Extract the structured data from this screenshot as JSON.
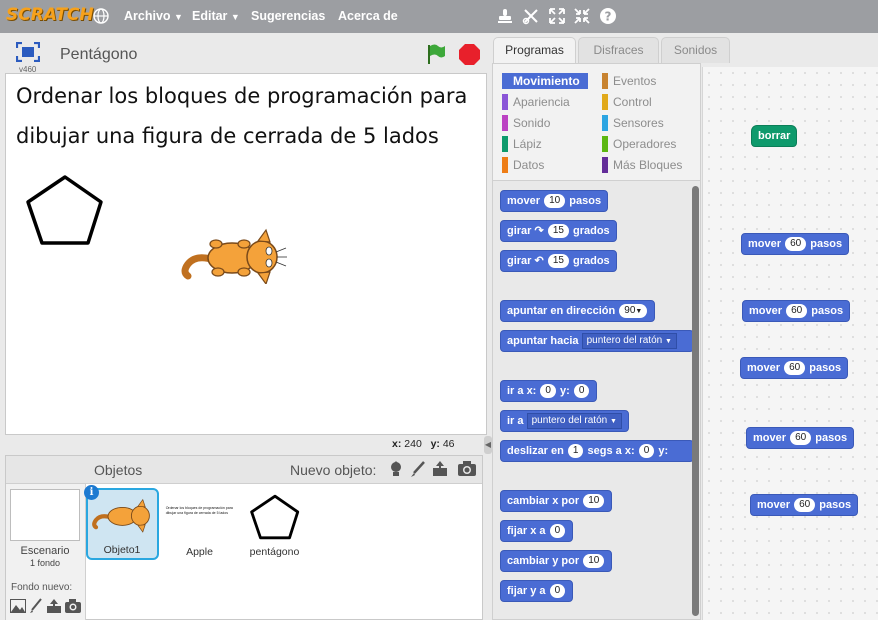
{
  "menubar": {
    "logo": "SCRATCH",
    "items": [
      "Archivo",
      "Editar",
      "Sugerencias",
      "Acerca de"
    ],
    "tool_icons": [
      "stamp-icon",
      "cut-icon",
      "grow-icon",
      "shrink-icon",
      "help-icon"
    ]
  },
  "stage": {
    "project_title": "Pentágono",
    "version": "v460",
    "text_line1": "Ordenar los bloques de programación para",
    "text_line2": "dibujar una figura de cerrada de 5 lados",
    "coords": {
      "x_label": "x:",
      "x_value": "240",
      "y_label": "y:",
      "y_value": "46"
    }
  },
  "sprites": {
    "header": "Objetos",
    "new_object": "Nuevo objeto:",
    "stage_label": "Escenario",
    "stage_count": "1 fondo",
    "new_backdrop": "Fondo nuevo:",
    "items": [
      {
        "name": "Objeto1",
        "selected": true
      },
      {
        "name": "Apple",
        "selected": false
      },
      {
        "name": "pentágono",
        "selected": false
      }
    ],
    "apple_thumb_text": "Ordenar los bloques de programación para dibujar una figura de cerrada de 5 lados"
  },
  "tabs": [
    "Programas",
    "Disfraces",
    "Sonidos"
  ],
  "categories": [
    {
      "label": "Movimiento",
      "color": "#4a6cd4"
    },
    {
      "label": "Eventos",
      "color": "#c88330"
    },
    {
      "label": "Apariencia",
      "color": "#8a55d7"
    },
    {
      "label": "Control",
      "color": "#e1a91a"
    },
    {
      "label": "Sonido",
      "color": "#bb42c3"
    },
    {
      "label": "Sensores",
      "color": "#2ca5e2"
    },
    {
      "label": "Lápiz",
      "color": "#0e9a6c"
    },
    {
      "label": "Operadores",
      "color": "#5cb712"
    },
    {
      "label": "Datos",
      "color": "#ee7d16"
    },
    {
      "label": "Más Bloques",
      "color": "#632d99"
    }
  ],
  "palette_blocks": {
    "move": {
      "pre": "mover",
      "val": "10",
      "post": "pasos"
    },
    "turn_right": {
      "pre": "girar",
      "val": "15",
      "post": "grados"
    },
    "turn_left": {
      "pre": "girar",
      "val": "15",
      "post": "grados"
    },
    "point_dir": {
      "pre": "apuntar en dirección",
      "val": "90"
    },
    "point_towards": {
      "pre": "apuntar hacia",
      "val": "puntero del ratón"
    },
    "goto_xy": {
      "pre": "ir a x:",
      "x": "0",
      "mid": "y:",
      "y": "0"
    },
    "goto": {
      "pre": "ir a",
      "val": "puntero del ratón"
    },
    "glide": {
      "pre": "deslizar en",
      "secs": "1",
      "mid": "segs a x:",
      "x": "0",
      "post": "y:"
    },
    "change_x": {
      "pre": "cambiar x por",
      "val": "10"
    },
    "set_x": {
      "pre": "fijar x a",
      "val": "0"
    },
    "change_y": {
      "pre": "cambiar y por",
      "val": "10"
    },
    "set_y": {
      "pre": "fijar y a",
      "val": "0"
    }
  },
  "scripts": {
    "clear_block": "borrar",
    "move_blocks": [
      {
        "pre": "mover",
        "val": "60",
        "post": "pasos"
      },
      {
        "pre": "mover",
        "val": "60",
        "post": "pasos"
      },
      {
        "pre": "mover",
        "val": "60",
        "post": "pasos"
      },
      {
        "pre": "mover",
        "val": "60",
        "post": "pasos"
      },
      {
        "pre": "mover",
        "val": "60",
        "post": "pasos"
      }
    ]
  }
}
